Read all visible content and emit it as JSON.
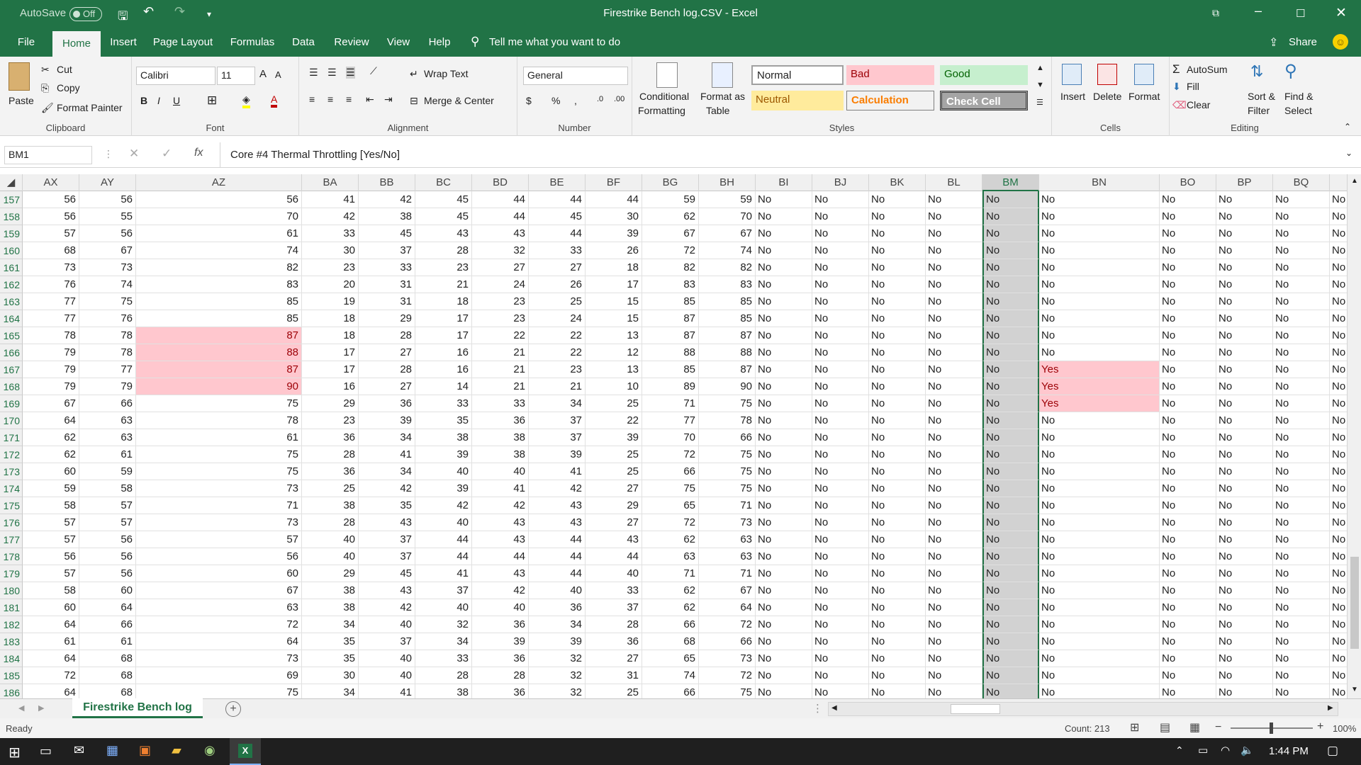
{
  "window": {
    "title": "Firestrike Bench log.CSV  -  Excel",
    "autosave_label": "AutoSave",
    "autosave_state": "Off"
  },
  "tabs": [
    "File",
    "Home",
    "Insert",
    "Page Layout",
    "Formulas",
    "Data",
    "Review",
    "View",
    "Help"
  ],
  "tell_me": "Tell me what you want to do",
  "share": "Share",
  "clipboard": {
    "paste": "Paste",
    "cut": "Cut",
    "copy": "Copy",
    "format_painter": "Format Painter",
    "label": "Clipboard"
  },
  "font": {
    "name": "Calibri",
    "size": "11",
    "label": "Font"
  },
  "alignment": {
    "wrap": "Wrap Text",
    "merge": "Merge & Center",
    "label": "Alignment"
  },
  "number": {
    "format": "General",
    "label": "Number"
  },
  "styles": {
    "conditional": "Conditional",
    "formatting": "Formatting",
    "format_as": "Format as",
    "table": "Table",
    "normal": "Normal",
    "bad": "Bad",
    "good": "Good",
    "neutral": "Neutral",
    "calculation": "Calculation",
    "check_cell": "Check Cell",
    "label": "Styles"
  },
  "cells": {
    "insert": "Insert",
    "delete": "Delete",
    "format": "Format",
    "label": "Cells"
  },
  "editing": {
    "autosum": "AutoSum",
    "fill": "Fill",
    "clear": "Clear",
    "sort": "Sort &",
    "filter": "Filter",
    "find": "Find &",
    "select": "Select",
    "label": "Editing"
  },
  "formula_bar": {
    "name_box": "BM1",
    "formula": "Core #4 Thermal Throttling [Yes/No]"
  },
  "columns": [
    "AX",
    "AY",
    "AZ",
    "BA",
    "BB",
    "BC",
    "BD",
    "BE",
    "BF",
    "BG",
    "BH",
    "BI",
    "BJ",
    "BK",
    "BL",
    "BM",
    "BN",
    "BO",
    "BP",
    "BQ"
  ],
  "rows": [
    {
      "n": "157",
      "v": [
        56,
        56,
        56,
        41,
        42,
        45,
        44,
        44,
        44,
        59,
        59,
        "No",
        "No",
        "No",
        "No",
        "No",
        "No",
        "No",
        "No",
        "No"
      ]
    },
    {
      "n": "158",
      "v": [
        56,
        55,
        70,
        42,
        38,
        45,
        44,
        45,
        30,
        62,
        70,
        "No",
        "No",
        "No",
        "No",
        "No",
        "No",
        "No",
        "No",
        "No"
      ]
    },
    {
      "n": "159",
      "v": [
        57,
        56,
        61,
        33,
        45,
        43,
        43,
        44,
        39,
        67,
        67,
        "No",
        "No",
        "No",
        "No",
        "No",
        "No",
        "No",
        "No",
        "No"
      ]
    },
    {
      "n": "160",
      "v": [
        68,
        67,
        74,
        30,
        37,
        28,
        32,
        33,
        26,
        72,
        74,
        "No",
        "No",
        "No",
        "No",
        "No",
        "No",
        "No",
        "No",
        "No"
      ]
    },
    {
      "n": "161",
      "v": [
        73,
        73,
        82,
        23,
        33,
        23,
        27,
        27,
        18,
        82,
        82,
        "No",
        "No",
        "No",
        "No",
        "No",
        "No",
        "No",
        "No",
        "No"
      ]
    },
    {
      "n": "162",
      "v": [
        76,
        74,
        83,
        20,
        31,
        21,
        24,
        26,
        17,
        83,
        83,
        "No",
        "No",
        "No",
        "No",
        "No",
        "No",
        "No",
        "No",
        "No"
      ]
    },
    {
      "n": "163",
      "v": [
        77,
        75,
        85,
        19,
        31,
        18,
        23,
        25,
        15,
        85,
        85,
        "No",
        "No",
        "No",
        "No",
        "No",
        "No",
        "No",
        "No",
        "No"
      ]
    },
    {
      "n": "164",
      "v": [
        77,
        76,
        85,
        18,
        29,
        17,
        23,
        24,
        15,
        87,
        85,
        "No",
        "No",
        "No",
        "No",
        "No",
        "No",
        "No",
        "No",
        "No"
      ]
    },
    {
      "n": "165",
      "v": [
        78,
        78,
        87,
        18,
        28,
        17,
        22,
        22,
        13,
        87,
        87,
        "No",
        "No",
        "No",
        "No",
        "No",
        "No",
        "No",
        "No",
        "No"
      ]
    },
    {
      "n": "166",
      "v": [
        79,
        78,
        88,
        17,
        27,
        16,
        21,
        22,
        12,
        88,
        88,
        "No",
        "No",
        "No",
        "No",
        "No",
        "No",
        "No",
        "No",
        "No"
      ]
    },
    {
      "n": "167",
      "v": [
        79,
        77,
        87,
        17,
        28,
        16,
        21,
        23,
        13,
        85,
        87,
        "No",
        "No",
        "No",
        "No",
        "No",
        "Yes",
        "No",
        "No",
        "No"
      ]
    },
    {
      "n": "168",
      "v": [
        79,
        79,
        90,
        16,
        27,
        14,
        21,
        21,
        10,
        89,
        90,
        "No",
        "No",
        "No",
        "No",
        "No",
        "Yes",
        "No",
        "No",
        "No"
      ]
    },
    {
      "n": "169",
      "v": [
        67,
        66,
        75,
        29,
        36,
        33,
        33,
        34,
        25,
        71,
        75,
        "No",
        "No",
        "No",
        "No",
        "No",
        "Yes",
        "No",
        "No",
        "No"
      ]
    },
    {
      "n": "170",
      "v": [
        64,
        63,
        78,
        23,
        39,
        35,
        36,
        37,
        22,
        77,
        78,
        "No",
        "No",
        "No",
        "No",
        "No",
        "No",
        "No",
        "No",
        "No"
      ]
    },
    {
      "n": "171",
      "v": [
        62,
        63,
        61,
        36,
        34,
        38,
        38,
        37,
        39,
        70,
        66,
        "No",
        "No",
        "No",
        "No",
        "No",
        "No",
        "No",
        "No",
        "No"
      ]
    },
    {
      "n": "172",
      "v": [
        62,
        61,
        75,
        28,
        41,
        39,
        38,
        39,
        25,
        72,
        75,
        "No",
        "No",
        "No",
        "No",
        "No",
        "No",
        "No",
        "No",
        "No"
      ]
    },
    {
      "n": "173",
      "v": [
        60,
        59,
        75,
        36,
        34,
        40,
        40,
        41,
        25,
        66,
        75,
        "No",
        "No",
        "No",
        "No",
        "No",
        "No",
        "No",
        "No",
        "No"
      ]
    },
    {
      "n": "174",
      "v": [
        59,
        58,
        73,
        25,
        42,
        39,
        41,
        42,
        27,
        75,
        75,
        "No",
        "No",
        "No",
        "No",
        "No",
        "No",
        "No",
        "No",
        "No"
      ]
    },
    {
      "n": "175",
      "v": [
        58,
        57,
        71,
        38,
        35,
        42,
        42,
        43,
        29,
        65,
        71,
        "No",
        "No",
        "No",
        "No",
        "No",
        "No",
        "No",
        "No",
        "No"
      ]
    },
    {
      "n": "176",
      "v": [
        57,
        57,
        73,
        28,
        43,
        40,
        43,
        43,
        27,
        72,
        73,
        "No",
        "No",
        "No",
        "No",
        "No",
        "No",
        "No",
        "No",
        "No"
      ]
    },
    {
      "n": "177",
      "v": [
        57,
        56,
        57,
        40,
        37,
        44,
        43,
        44,
        43,
        62,
        63,
        "No",
        "No",
        "No",
        "No",
        "No",
        "No",
        "No",
        "No",
        "No"
      ]
    },
    {
      "n": "178",
      "v": [
        56,
        56,
        56,
        40,
        37,
        44,
        44,
        44,
        44,
        63,
        63,
        "No",
        "No",
        "No",
        "No",
        "No",
        "No",
        "No",
        "No",
        "No"
      ]
    },
    {
      "n": "179",
      "v": [
        57,
        56,
        60,
        29,
        45,
        41,
        43,
        44,
        40,
        71,
        71,
        "No",
        "No",
        "No",
        "No",
        "No",
        "No",
        "No",
        "No",
        "No"
      ]
    },
    {
      "n": "180",
      "v": [
        58,
        60,
        67,
        38,
        43,
        37,
        42,
        40,
        33,
        62,
        67,
        "No",
        "No",
        "No",
        "No",
        "No",
        "No",
        "No",
        "No",
        "No"
      ]
    },
    {
      "n": "181",
      "v": [
        60,
        64,
        63,
        38,
        42,
        40,
        40,
        36,
        37,
        62,
        64,
        "No",
        "No",
        "No",
        "No",
        "No",
        "No",
        "No",
        "No",
        "No"
      ]
    },
    {
      "n": "182",
      "v": [
        64,
        66,
        72,
        34,
        40,
        32,
        36,
        34,
        28,
        66,
        72,
        "No",
        "No",
        "No",
        "No",
        "No",
        "No",
        "No",
        "No",
        "No"
      ]
    },
    {
      "n": "183",
      "v": [
        61,
        61,
        64,
        35,
        37,
        34,
        39,
        39,
        36,
        68,
        66,
        "No",
        "No",
        "No",
        "No",
        "No",
        "No",
        "No",
        "No",
        "No"
      ]
    },
    {
      "n": "184",
      "v": [
        64,
        68,
        73,
        35,
        40,
        33,
        36,
        32,
        27,
        65,
        73,
        "No",
        "No",
        "No",
        "No",
        "No",
        "No",
        "No",
        "No",
        "No"
      ]
    },
    {
      "n": "185",
      "v": [
        72,
        68,
        69,
        30,
        40,
        28,
        28,
        32,
        31,
        74,
        72,
        "No",
        "No",
        "No",
        "No",
        "No",
        "No",
        "No",
        "No",
        "No"
      ]
    },
    {
      "n": "186",
      "v": [
        64,
        68,
        75,
        34,
        41,
        38,
        36,
        32,
        25,
        66,
        75,
        "No",
        "No",
        "No",
        "No",
        "No",
        "No",
        "No",
        "No",
        "No"
      ]
    }
  ],
  "partial_col": "No",
  "sheet_tab": "Firestrike Bench log",
  "status": {
    "ready": "Ready",
    "count": "Count: 213",
    "zoom": "100%"
  },
  "taskbar": {
    "time": "1:44 PM"
  },
  "colors": {
    "excel_green": "#217346",
    "bad_fill": "#ffc7ce",
    "bad_text": "#9c0006"
  }
}
